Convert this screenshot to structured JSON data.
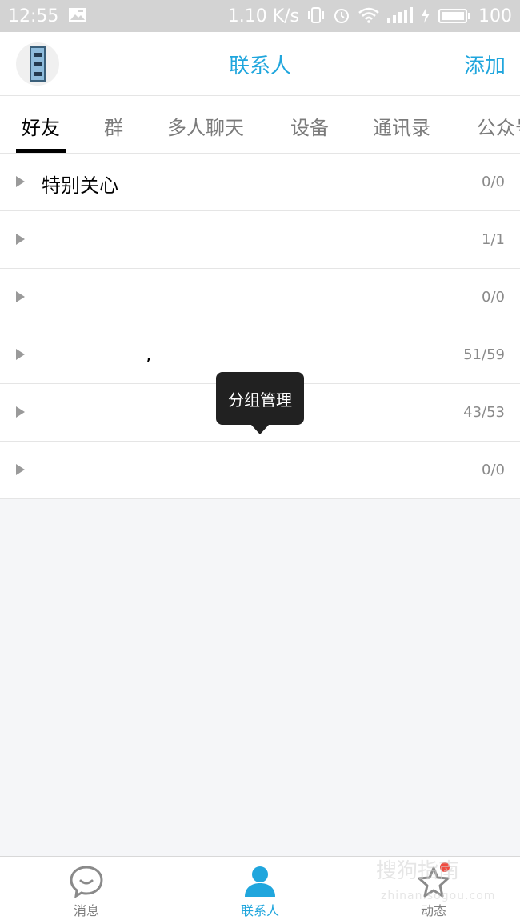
{
  "status_bar": {
    "time": "12:55",
    "net_speed": "1.10 K/s",
    "battery": "100",
    "icons": [
      "image-icon",
      "vibrate-icon",
      "alarm-icon",
      "wifi-icon",
      "signal-icon",
      "charging-icon",
      "battery-icon"
    ]
  },
  "header": {
    "title": "联系人",
    "add_label": "添加",
    "avatar_icon": "avatar-icon"
  },
  "tabs": [
    {
      "label": "好友",
      "active": true
    },
    {
      "label": "群",
      "active": false
    },
    {
      "label": "多人聊天",
      "active": false
    },
    {
      "label": "设备",
      "active": false
    },
    {
      "label": "通讯录",
      "active": false
    },
    {
      "label": "公众号",
      "active": false
    }
  ],
  "groups": [
    {
      "name": "特别关心",
      "count": "0/0"
    },
    {
      "name": "",
      "count": "1/1"
    },
    {
      "name": "",
      "count": "0/0"
    },
    {
      "name": ",",
      "count": "51/59"
    },
    {
      "name": "",
      "count": "43/53"
    },
    {
      "name": "",
      "count": "0/0"
    }
  ],
  "tooltip": {
    "label": "分组管理"
  },
  "bottom_nav": [
    {
      "label": "消息",
      "icon": "chat-bubble-icon",
      "active": false
    },
    {
      "label": "联系人",
      "icon": "person-icon",
      "active": true
    },
    {
      "label": "动态",
      "icon": "star-icon",
      "active": false
    }
  ],
  "watermark": {
    "text": "搜狗指南",
    "url": "zhinan.sogou.com"
  },
  "colors": {
    "accent": "#20a6dd",
    "badge": "#f04a3f",
    "status_bar": "#d3d3d3"
  }
}
